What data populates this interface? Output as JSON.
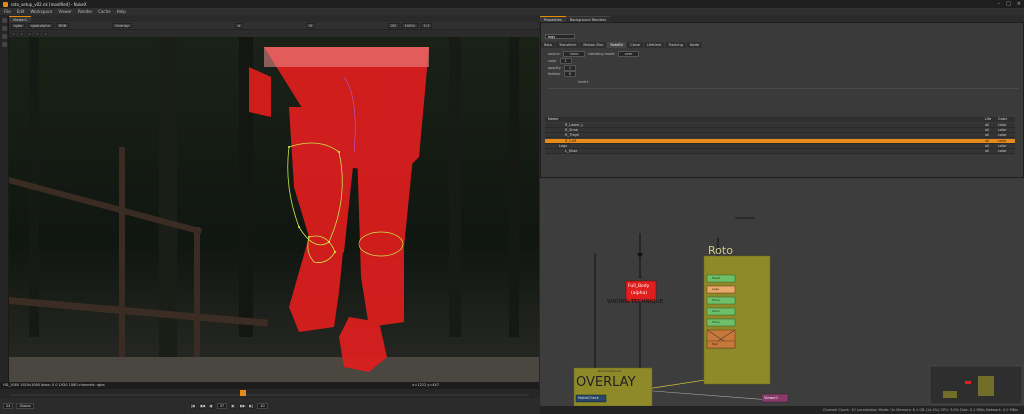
{
  "window": {
    "title": "roto_setup_v02.nk [modified] - NukeX"
  },
  "menu": [
    "File",
    "Edit",
    "Workspace",
    "Viewer",
    "Render",
    "Cache",
    "Help"
  ],
  "viewer": {
    "tab_label": "Viewer1",
    "toolbar": {
      "channels": "rgba",
      "channel_sub": "rgba.alpha",
      "rgb": "RGB",
      "input_a": "A",
      "input_b": "B",
      "overlay": "Overlay",
      "zoom": "100%",
      "ratio": "1:1",
      "mode_3d": "2D"
    },
    "status_left": "HD_1080 1920x1080  bbox: 0 0 1920 1080 channels: rgba",
    "status_right": "x=1222 y=447",
    "frame": "37",
    "fps": "24",
    "increment": "10",
    "playback_label": "Global"
  },
  "properties": {
    "tabs": [
      "Properties",
      "Background Renders"
    ],
    "node_name": "legs",
    "subtabs": [
      "Roto",
      "Transform",
      "Motion Blur",
      "RotoBlr",
      "Clone",
      "Lifetime",
      "Tracking",
      "Node"
    ],
    "active_subtab": "RotoBlr",
    "fields": {
      "source_label": "source",
      "source_value": "none",
      "blending_label": "blending mode",
      "blending_value": "over",
      "color_label": "color",
      "color_value": "1",
      "opacity_label": "opacity",
      "opacity_value": "1",
      "feather_label": "feather",
      "feather_value": "0",
      "invert_label": "invert"
    },
    "layers": {
      "header": {
        "name": "Name",
        "life": "Life",
        "color": "Color"
      },
      "rows": [
        {
          "name": "R_Lower_L",
          "life": "all",
          "color": "color",
          "selected": false
        },
        {
          "name": "R_Shoe",
          "life": "all",
          "color": "color",
          "selected": false
        },
        {
          "name": "R_Thigh",
          "life": "all",
          "color": "color",
          "selected": false
        },
        {
          "name": "R_Calf",
          "life": "all",
          "color": "color",
          "selected": true
        },
        {
          "name": "Legs",
          "life": "all",
          "color": "color",
          "selected": false
        },
        {
          "name": "L_Shoe",
          "life": "all",
          "color": "color",
          "selected": false
        }
      ]
    }
  },
  "dag": {
    "roto_backdrop_label": "Roto",
    "overlay_backdrop_label": "OVERLAY",
    "overlay_backdrop_title": "BackdropNode1",
    "wrong_node": {
      "line1": "Full_Body",
      "line2": "(alpha)",
      "caption": "WRONG TECHNIQUE"
    },
    "small_label": "Fg",
    "roto_nodes": [
      "Head",
      "Legs",
      "Torso",
      "Arms",
      "Shoe",
      "Hair"
    ],
    "merge_node": "MatteCheck",
    "viewer_node": "Viewer1",
    "status": "Channel Count: 10  Localization Mode: On  Memory: 6.1 GB (14.4%)  CPU: 3.0%  Disk: 0.1 MB/s  Network: 0.0 MB/s"
  },
  "colors": {
    "accent": "#e88a1a",
    "roto_red": "#e01e1e",
    "backdrop": "#8e8a2a"
  }
}
